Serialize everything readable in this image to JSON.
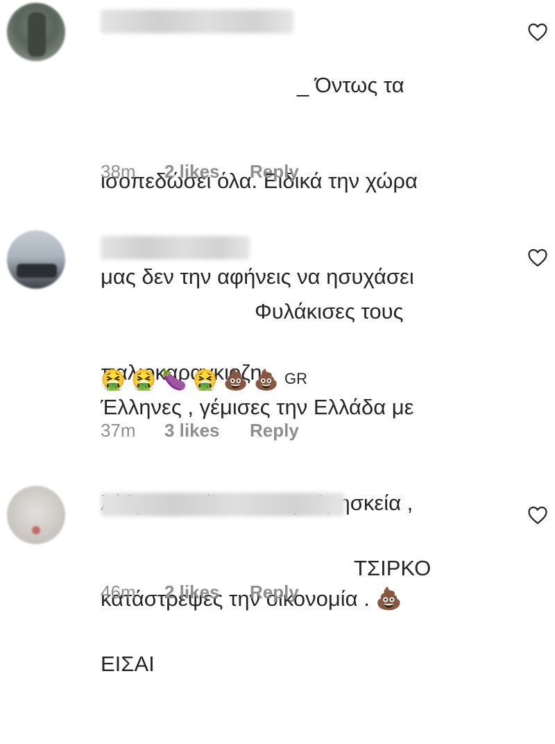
{
  "comments": [
    {
      "text_lines": [
        "_ Όντως τα",
        "ισοπεδώσει όλα. Ειδικά την χώρα",
        "μας δεν την αφήνεις να ησυχάσει",
        "παλιοκαραγκιοζη"
      ],
      "time": "38m",
      "likes": "2 likes",
      "reply": "Reply",
      "heart_icon": "heart-outline-icon"
    },
    {
      "text_lines": [
        "Φυλάκισες τους",
        "Έλληνες , γέμισες την Ελλάδα με",
        "λάθρο , σπίλωσες την θρησκεία ,",
        "κατάστρεψες την οικονομία . 💩"
      ],
      "emoji_line": "🤮 🤮 🍆 🤮 💩 💩",
      "emoji_tail": "GR",
      "time": "37m",
      "likes": "3 likes",
      "reply": "Reply",
      "heart_icon": "heart-outline-icon"
    },
    {
      "text_lines": [
        "ΤΣΙΡΚΟ",
        "ΕΙΣΑΙ"
      ],
      "time": "46m",
      "likes": "2 likes",
      "reply": "Reply",
      "heart_icon": "heart-outline-icon"
    }
  ],
  "colors": {
    "text": "#262626",
    "meta": "#8e8e8e"
  }
}
